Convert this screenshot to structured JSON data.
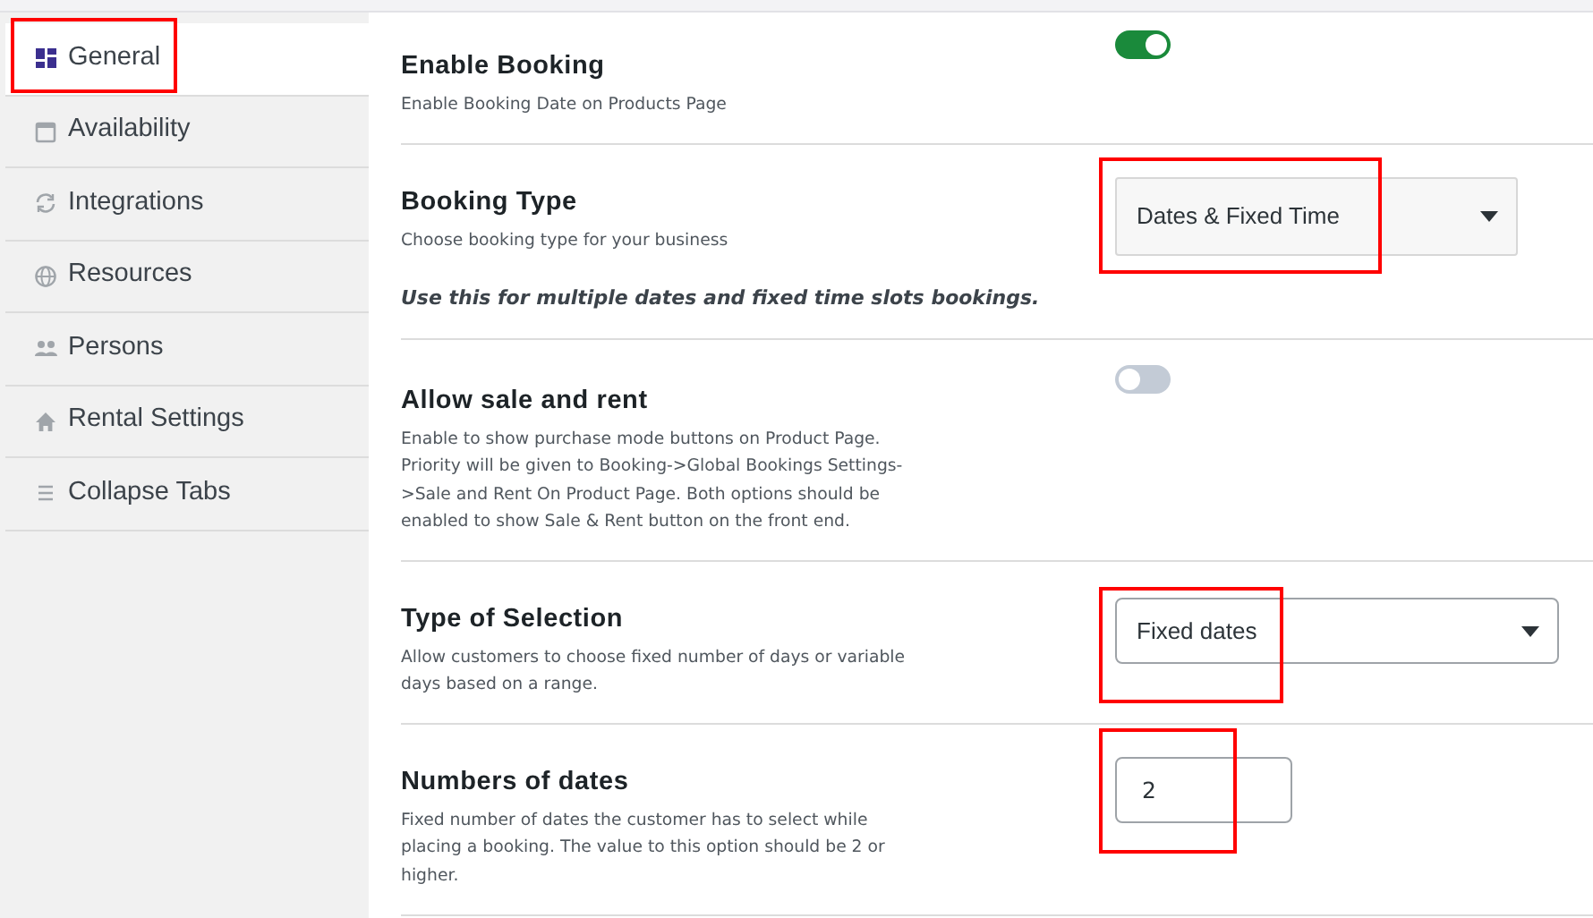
{
  "sidebar": {
    "items": [
      {
        "label": "General",
        "selected": true,
        "highlighted": true
      },
      {
        "label": "Availability",
        "selected": false,
        "highlighted": false
      },
      {
        "label": "Integrations",
        "selected": false,
        "highlighted": false
      },
      {
        "label": "Resources",
        "selected": false,
        "highlighted": false
      },
      {
        "label": "Persons",
        "selected": false,
        "highlighted": false
      },
      {
        "label": "Rental Settings",
        "selected": false,
        "highlighted": false
      },
      {
        "label": "Collapse Tabs",
        "selected": false,
        "highlighted": false
      }
    ]
  },
  "settings": [
    {
      "kind": "toggle",
      "title": "Enable Booking",
      "description": "Enable Booking Date on Products Page",
      "on": true
    },
    {
      "kind": "select",
      "title": "Booking Type",
      "description": "Choose booking type for your business",
      "value": "Dates & Fixed Time",
      "note": "Use this for multiple dates and fixed time slots bookings.",
      "highlighted": true
    },
    {
      "kind": "toggle",
      "title": "Allow sale and rent",
      "description": "Enable to show purchase mode buttons on Product Page. Priority will be given to Booking->Global Bookings Settings->Sale and Rent On Product Page. Both options should be enabled to show Sale & Rent button on the front end.",
      "on": false
    },
    {
      "kind": "select",
      "title": "Type of Selection",
      "description": "Allow customers to choose fixed number of days or variable days based on a range.",
      "value": "Fixed dates",
      "highlighted": true
    },
    {
      "kind": "number",
      "title": "Numbers of dates",
      "description": "Fixed number of dates the customer has to select while placing a booking. The value to this option should be 2 or higher.",
      "value": "2",
      "highlighted": true
    }
  ]
}
